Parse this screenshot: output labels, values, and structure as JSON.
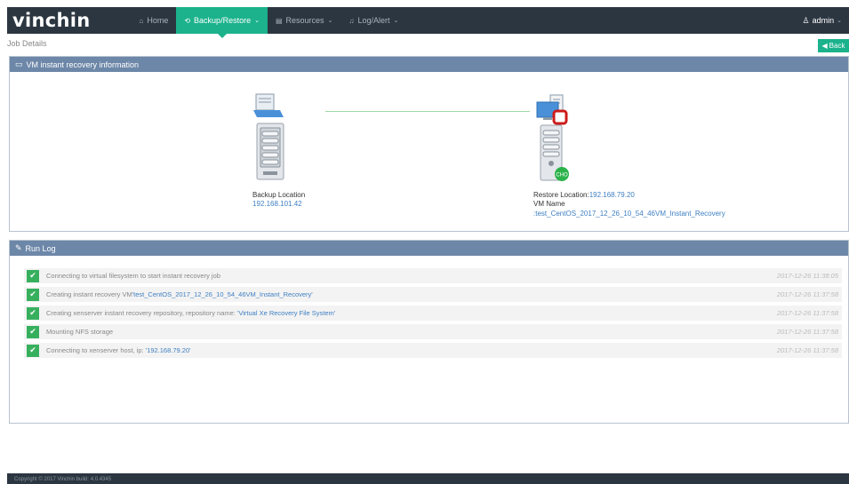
{
  "brand": "vinchin",
  "nav": {
    "home": "Home",
    "backup": "Backup/Restore",
    "resources": "Resources",
    "log": "Log/Alert"
  },
  "user": {
    "name": "admin",
    "icon": "user-icon"
  },
  "page_title": "Job Details",
  "back_label": "Back",
  "vm_panel": {
    "title": "VM instant recovery information",
    "backup_label": "Backup Location",
    "backup_ip": "192.168.101.42",
    "restore_label": "Restore Location:",
    "restore_ip": "192.168.79.20",
    "vm_name_label": "VM Name",
    "vm_name": ":test_CentOS_2017_12_26_10_54_46VM_Instant_Recovery",
    "status_badge": "CHO"
  },
  "log_panel": {
    "title": "Run Log",
    "rows": [
      {
        "pre": "Connecting to virtual filesystem to start instant recovery job",
        "link": "",
        "post": "",
        "time": "2017-12-26 11:38:05"
      },
      {
        "pre": "Creating instant recovery VM",
        "link": "'test_CentOS_2017_12_26_10_54_46VM_Instant_Recovery'",
        "post": "",
        "time": "2017-12-26 11:37:58"
      },
      {
        "pre": "Creating xenserver instant recovery repository, repository name: ",
        "link": "'Virtual Xe Recovery File System'",
        "post": "",
        "time": "2017-12-26 11:37:58"
      },
      {
        "pre": "Mounting NFS storage",
        "link": "",
        "post": "",
        "time": "2017-12-26 11:37:58"
      },
      {
        "pre": "Connecting to xenserver host, ip: ",
        "link": "'192.168.79.20'",
        "post": "",
        "time": "2017-12-26 11:37:58"
      }
    ]
  },
  "footer": "Copyright © 2017 Vinchin build: 4.0.4345",
  "colors": {
    "accent": "#1bb28c",
    "topbar": "#2c3641",
    "panel_header": "#6d87a8",
    "success": "#37b05e",
    "link": "#3e7fc1"
  }
}
